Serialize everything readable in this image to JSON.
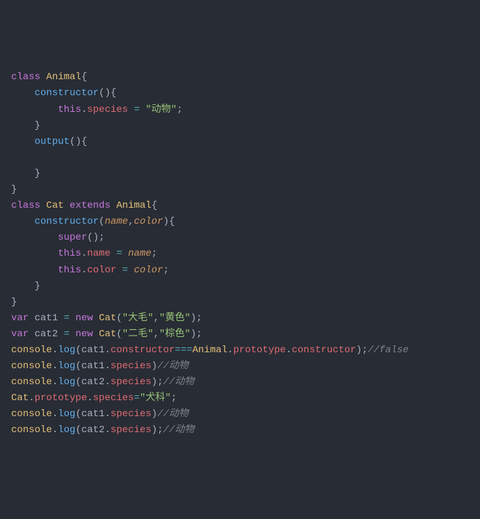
{
  "tokens": {
    "kw_class": "class",
    "kw_var": "var",
    "kw_new": "new",
    "kw_extends": "extends",
    "kw_this": "this",
    "kw_super": "super",
    "cls_Animal": "Animal",
    "cls_Cat": "Cat",
    "cls_console": "console",
    "fn_constructor": "constructor",
    "fn_output": "output",
    "fn_log": "log",
    "prop_species": "species",
    "prop_name": "name",
    "prop_color": "color",
    "prop_prototype": "prototype",
    "prop_constructor": "constructor",
    "param_name": "name",
    "param_color": "color",
    "var_cat1": "cat1",
    "var_cat2": "cat2",
    "op_eq": "=",
    "op_seq": "===",
    "str_species_val": "\"动物\"",
    "str_damao": "\"大毛\"",
    "str_huangse": "\"黄色\"",
    "str_ermao": "\"二毛\"",
    "str_zongse": "\"棕色\"",
    "str_quanke": "\"犬科\"",
    "cmt_false": "//false",
    "cmt_dongwu": "//动物",
    "p_lbrace": "{",
    "p_rbrace": "}",
    "p_lparen": "(",
    "p_rparen": ")",
    "p_semi": ";",
    "p_comma": ",",
    "p_dot": "."
  }
}
